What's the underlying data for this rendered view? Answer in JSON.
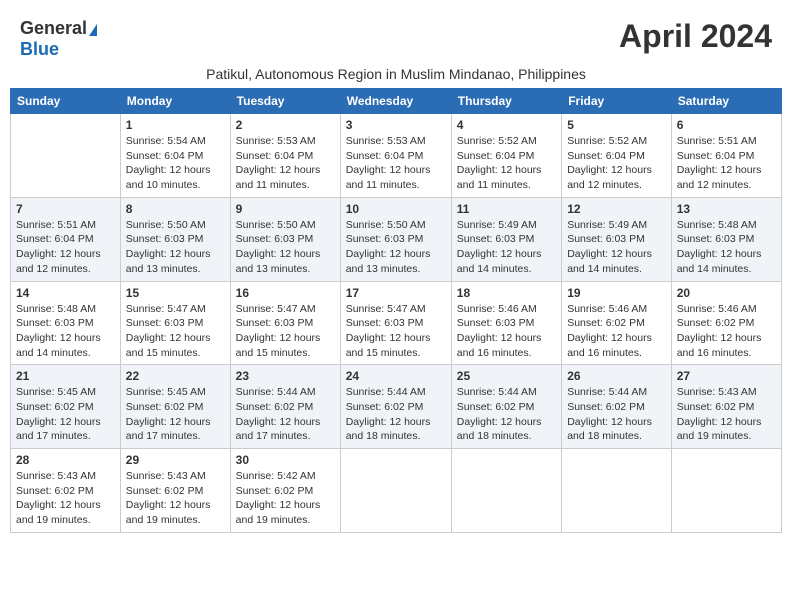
{
  "header": {
    "logo_general": "General",
    "logo_blue": "Blue",
    "month_title": "April 2024",
    "subtitle": "Patikul, Autonomous Region in Muslim Mindanao, Philippines"
  },
  "weekdays": [
    "Sunday",
    "Monday",
    "Tuesday",
    "Wednesday",
    "Thursday",
    "Friday",
    "Saturday"
  ],
  "weeks": [
    [
      {
        "day": "",
        "sunrise": "",
        "sunset": "",
        "daylight": ""
      },
      {
        "day": "1",
        "sunrise": "Sunrise: 5:54 AM",
        "sunset": "Sunset: 6:04 PM",
        "daylight": "Daylight: 12 hours and 10 minutes."
      },
      {
        "day": "2",
        "sunrise": "Sunrise: 5:53 AM",
        "sunset": "Sunset: 6:04 PM",
        "daylight": "Daylight: 12 hours and 11 minutes."
      },
      {
        "day": "3",
        "sunrise": "Sunrise: 5:53 AM",
        "sunset": "Sunset: 6:04 PM",
        "daylight": "Daylight: 12 hours and 11 minutes."
      },
      {
        "day": "4",
        "sunrise": "Sunrise: 5:52 AM",
        "sunset": "Sunset: 6:04 PM",
        "daylight": "Daylight: 12 hours and 11 minutes."
      },
      {
        "day": "5",
        "sunrise": "Sunrise: 5:52 AM",
        "sunset": "Sunset: 6:04 PM",
        "daylight": "Daylight: 12 hours and 12 minutes."
      },
      {
        "day": "6",
        "sunrise": "Sunrise: 5:51 AM",
        "sunset": "Sunset: 6:04 PM",
        "daylight": "Daylight: 12 hours and 12 minutes."
      }
    ],
    [
      {
        "day": "7",
        "sunrise": "Sunrise: 5:51 AM",
        "sunset": "Sunset: 6:04 PM",
        "daylight": "Daylight: 12 hours and 12 minutes."
      },
      {
        "day": "8",
        "sunrise": "Sunrise: 5:50 AM",
        "sunset": "Sunset: 6:03 PM",
        "daylight": "Daylight: 12 hours and 13 minutes."
      },
      {
        "day": "9",
        "sunrise": "Sunrise: 5:50 AM",
        "sunset": "Sunset: 6:03 PM",
        "daylight": "Daylight: 12 hours and 13 minutes."
      },
      {
        "day": "10",
        "sunrise": "Sunrise: 5:50 AM",
        "sunset": "Sunset: 6:03 PM",
        "daylight": "Daylight: 12 hours and 13 minutes."
      },
      {
        "day": "11",
        "sunrise": "Sunrise: 5:49 AM",
        "sunset": "Sunset: 6:03 PM",
        "daylight": "Daylight: 12 hours and 14 minutes."
      },
      {
        "day": "12",
        "sunrise": "Sunrise: 5:49 AM",
        "sunset": "Sunset: 6:03 PM",
        "daylight": "Daylight: 12 hours and 14 minutes."
      },
      {
        "day": "13",
        "sunrise": "Sunrise: 5:48 AM",
        "sunset": "Sunset: 6:03 PM",
        "daylight": "Daylight: 12 hours and 14 minutes."
      }
    ],
    [
      {
        "day": "14",
        "sunrise": "Sunrise: 5:48 AM",
        "sunset": "Sunset: 6:03 PM",
        "daylight": "Daylight: 12 hours and 14 minutes."
      },
      {
        "day": "15",
        "sunrise": "Sunrise: 5:47 AM",
        "sunset": "Sunset: 6:03 PM",
        "daylight": "Daylight: 12 hours and 15 minutes."
      },
      {
        "day": "16",
        "sunrise": "Sunrise: 5:47 AM",
        "sunset": "Sunset: 6:03 PM",
        "daylight": "Daylight: 12 hours and 15 minutes."
      },
      {
        "day": "17",
        "sunrise": "Sunrise: 5:47 AM",
        "sunset": "Sunset: 6:03 PM",
        "daylight": "Daylight: 12 hours and 15 minutes."
      },
      {
        "day": "18",
        "sunrise": "Sunrise: 5:46 AM",
        "sunset": "Sunset: 6:03 PM",
        "daylight": "Daylight: 12 hours and 16 minutes."
      },
      {
        "day": "19",
        "sunrise": "Sunrise: 5:46 AM",
        "sunset": "Sunset: 6:02 PM",
        "daylight": "Daylight: 12 hours and 16 minutes."
      },
      {
        "day": "20",
        "sunrise": "Sunrise: 5:46 AM",
        "sunset": "Sunset: 6:02 PM",
        "daylight": "Daylight: 12 hours and 16 minutes."
      }
    ],
    [
      {
        "day": "21",
        "sunrise": "Sunrise: 5:45 AM",
        "sunset": "Sunset: 6:02 PM",
        "daylight": "Daylight: 12 hours and 17 minutes."
      },
      {
        "day": "22",
        "sunrise": "Sunrise: 5:45 AM",
        "sunset": "Sunset: 6:02 PM",
        "daylight": "Daylight: 12 hours and 17 minutes."
      },
      {
        "day": "23",
        "sunrise": "Sunrise: 5:44 AM",
        "sunset": "Sunset: 6:02 PM",
        "daylight": "Daylight: 12 hours and 17 minutes."
      },
      {
        "day": "24",
        "sunrise": "Sunrise: 5:44 AM",
        "sunset": "Sunset: 6:02 PM",
        "daylight": "Daylight: 12 hours and 18 minutes."
      },
      {
        "day": "25",
        "sunrise": "Sunrise: 5:44 AM",
        "sunset": "Sunset: 6:02 PM",
        "daylight": "Daylight: 12 hours and 18 minutes."
      },
      {
        "day": "26",
        "sunrise": "Sunrise: 5:44 AM",
        "sunset": "Sunset: 6:02 PM",
        "daylight": "Daylight: 12 hours and 18 minutes."
      },
      {
        "day": "27",
        "sunrise": "Sunrise: 5:43 AM",
        "sunset": "Sunset: 6:02 PM",
        "daylight": "Daylight: 12 hours and 19 minutes."
      }
    ],
    [
      {
        "day": "28",
        "sunrise": "Sunrise: 5:43 AM",
        "sunset": "Sunset: 6:02 PM",
        "daylight": "Daylight: 12 hours and 19 minutes."
      },
      {
        "day": "29",
        "sunrise": "Sunrise: 5:43 AM",
        "sunset": "Sunset: 6:02 PM",
        "daylight": "Daylight: 12 hours and 19 minutes."
      },
      {
        "day": "30",
        "sunrise": "Sunrise: 5:42 AM",
        "sunset": "Sunset: 6:02 PM",
        "daylight": "Daylight: 12 hours and 19 minutes."
      },
      {
        "day": "",
        "sunrise": "",
        "sunset": "",
        "daylight": ""
      },
      {
        "day": "",
        "sunrise": "",
        "sunset": "",
        "daylight": ""
      },
      {
        "day": "",
        "sunrise": "",
        "sunset": "",
        "daylight": ""
      },
      {
        "day": "",
        "sunrise": "",
        "sunset": "",
        "daylight": ""
      }
    ]
  ]
}
